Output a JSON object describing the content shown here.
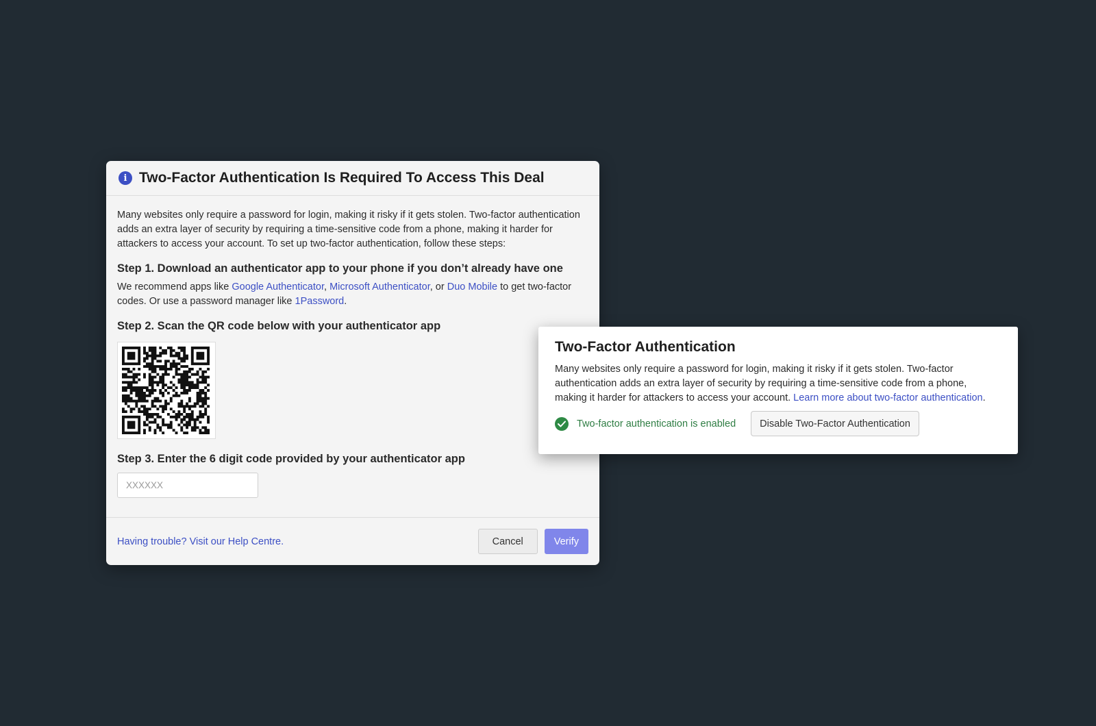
{
  "modal": {
    "title": "Two-Factor Authentication Is Required To Access This Deal",
    "intro": "Many websites only require a password for login, making it risky if it gets stolen. Two-factor authentication adds an extra layer of security by requiring a time-sensitive code from a phone, making it harder for attackers to access your account. To set up two-factor authentication, follow these steps:",
    "step1": {
      "heading": "Step 1. Download an authenticator app to your phone if you don’t already have one",
      "text_prefix": "We recommend apps like ",
      "link_google": "Google Authenticator",
      "sep1": ", ",
      "link_microsoft": "Microsoft Authenticator",
      "sep2": ", or ",
      "link_duo": "Duo Mobile",
      "text_mid": " to get two-factor codes. Or use a password manager like ",
      "link_1password": "1Password",
      "text_end": "."
    },
    "step2": {
      "heading": "Step 2. Scan the QR code below with your authenticator app"
    },
    "step3": {
      "heading": "Step 3. Enter the 6 digit code provided by your authenticator app",
      "placeholder": "XXXXXX"
    },
    "footer": {
      "help_link": "Having trouble? Visit our Help Centre.",
      "cancel_label": "Cancel",
      "verify_label": "Verify"
    }
  },
  "card": {
    "title": "Two-Factor Authentication",
    "text": "Many websites only require a password for login, making it risky if it gets stolen. Two-factor authentication adds an extra layer of security by requiring a time-sensitive code from a phone, making it harder for attackers to access your account. ",
    "learn_more": "Learn more about two-factor authentication",
    "text_end": ".",
    "status": "Two-factor authentication is enabled",
    "disable_label": "Disable Two-Factor Authentication"
  },
  "colors": {
    "background": "#212b33",
    "accent": "#3c4fc4",
    "verify_button": "#8086ea",
    "success": "#2e8a45"
  },
  "icons": {
    "info": "info-icon",
    "check": "check-circle-icon",
    "qr": "qr-code"
  }
}
